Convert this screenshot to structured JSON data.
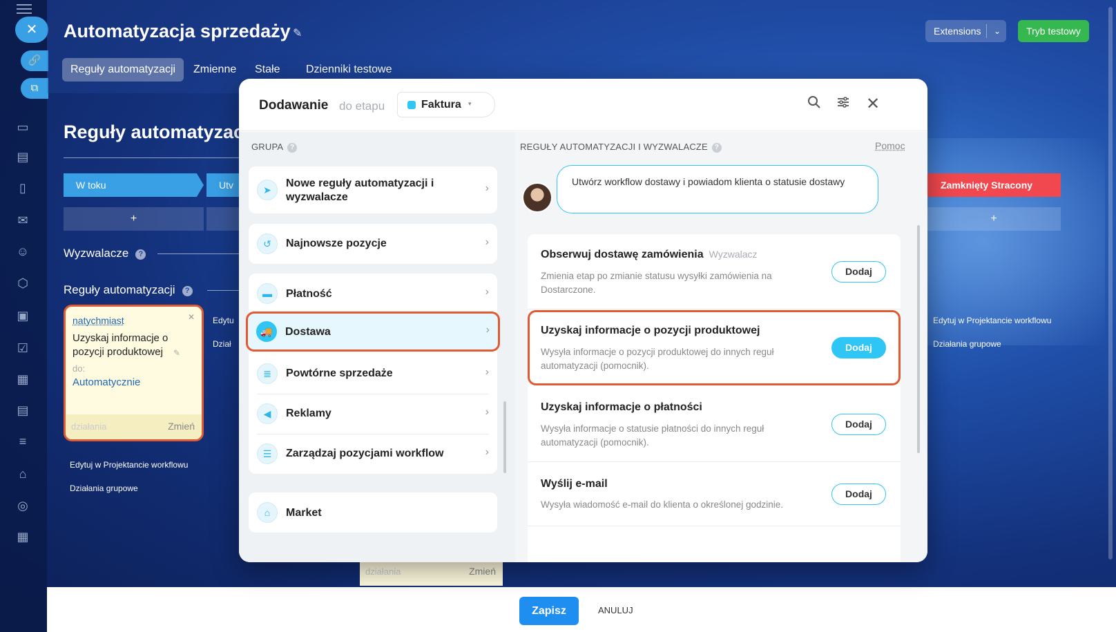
{
  "page": {
    "title": "Automatyzacja sprzedaży",
    "extensions_label": "Extensions",
    "test_mode_label": "Tryb testowy",
    "tabs": [
      {
        "label": "Reguły automatyzacji",
        "active": true
      },
      {
        "label": "Zmienne",
        "active": false
      },
      {
        "label": "Stałe",
        "active": false
      },
      {
        "label": "Dzienniki testowe",
        "active": false
      }
    ],
    "section_title": "Reguły automatyzac",
    "stages": [
      {
        "label": "W toku",
        "color": "#3aa0e6"
      },
      {
        "label": "Utv",
        "color": "#3aa0e6"
      },
      {
        "label": "Zamknięty Stracony",
        "color": "#f0484e"
      }
    ],
    "plus": "+",
    "triggers_label": "Wyzwalacze",
    "rules_label": "Reguły automatyzacji",
    "rule_card": {
      "when": "natychmiast",
      "text": "Uzyskaj informacje o pozycji produktowej",
      "to": "do:",
      "assignee": "Automatycznie",
      "actions": "działania",
      "change": "Zmień"
    },
    "links": {
      "edit_designer": "Edytuj w Projektancie workflowu",
      "group_actions": "Działania grupowe",
      "edit_short": "Edytu",
      "actions_short": "Dział",
      "edit_right_prefix": "wu"
    },
    "bottom_card": {
      "actions": "działania",
      "change": "Zmień"
    },
    "footer": {
      "save": "Zapisz",
      "cancel": "ANULUJ"
    }
  },
  "modal": {
    "title": "Dodawanie",
    "subtitle": "do etapu",
    "stage": {
      "label": "Faktura",
      "color": "#2fc6f6"
    },
    "group_label": "GRUPA",
    "rules_label": "REGUŁY AUTOMATYZACJI I WYZWALACZE",
    "help": "Pomoc",
    "groups": [
      {
        "label": "Nowe reguły automatyzacji i wyzwalacze",
        "icon": "rocket-icon"
      },
      {
        "label": "Najnowsze pozycje",
        "icon": "history-icon"
      },
      {
        "label": "Płatność",
        "icon": "wallet-icon"
      },
      {
        "label": "Dostawa",
        "icon": "truck-icon",
        "selected": true
      },
      {
        "label": "Powtórne sprzedaże",
        "icon": "stack-icon"
      },
      {
        "label": "Reklamy",
        "icon": "megaphone-icon"
      },
      {
        "label": "Zarządzaj pozycjami workflow",
        "icon": "filter-icon"
      },
      {
        "label": "Market",
        "icon": "market-icon"
      }
    ],
    "prompt": "Utwórz workflow dostawy i powiadom klienta o statusie dostawy",
    "rules": [
      {
        "title": "Obserwuj dostawę zamówienia",
        "tag": "Wyzwalacz",
        "desc": "Zmienia etap po zmianie statusu wysyłki zamówienia na Dostarczone.",
        "button": "Dodaj"
      },
      {
        "title": "Uzyskaj informacje o pozycji produktowej",
        "tag": "",
        "desc": "Wysyła informacje o pozycji produktowej do innych reguł automatyzacji (pomocnik).",
        "button": "Dodaj",
        "highlight": true
      },
      {
        "title": "Uzyskaj informacje o płatności",
        "tag": "",
        "desc": "Wysyła informacje o statusie płatności do innych reguł automatyzacji (pomocnik).",
        "button": "Dodaj"
      },
      {
        "title": "Wyślij e-mail",
        "tag": "",
        "desc": "Wysyła wiadomość e-mail do klienta o określonej godzinie.",
        "button": "Dodaj"
      }
    ]
  }
}
